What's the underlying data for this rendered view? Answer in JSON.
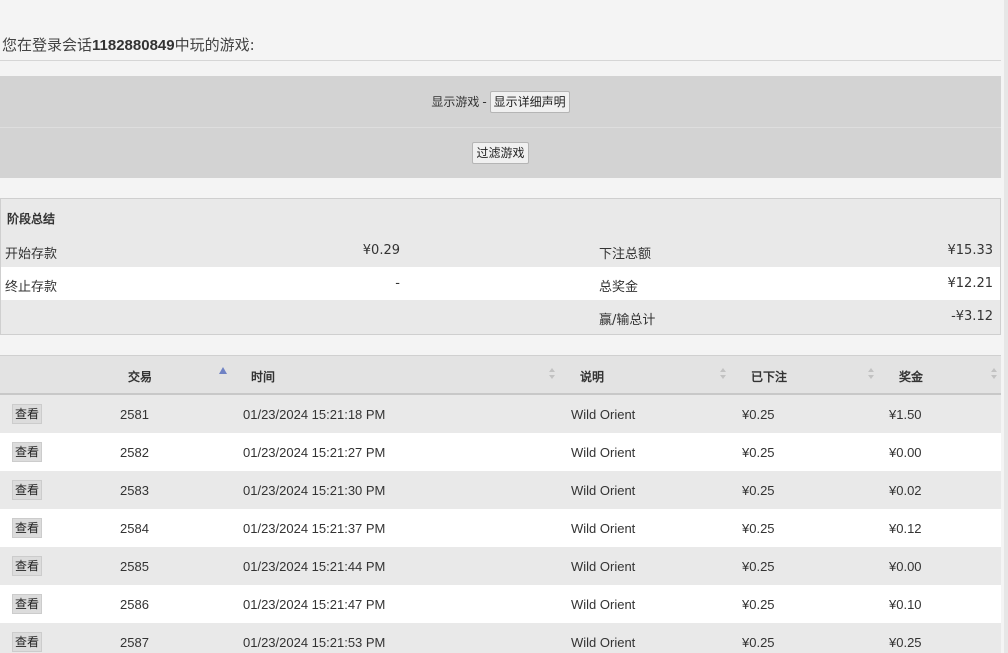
{
  "session": {
    "prefix": "您在登录会话",
    "session_id": "1182880849",
    "suffix": "中玩的游戏:"
  },
  "filters": {
    "show_games_label": "显示游戏",
    "separator": "-",
    "show_details_button": "显示详细声明",
    "filter_games_button": "过滤游戏"
  },
  "summary": {
    "title": "阶段总结",
    "rows": [
      {
        "label1": "开始存款",
        "value1": "¥0.29",
        "label2": "下注总额",
        "value2": "¥15.33"
      },
      {
        "label1": "终止存款",
        "value1": "-",
        "label2": "总奖金",
        "value2": "¥12.21"
      },
      {
        "label1": "",
        "value1": "",
        "label2": "赢/输总计",
        "value2": "-¥3.12"
      }
    ]
  },
  "grid": {
    "columns": [
      "交易",
      "时间",
      "说明",
      "已下注",
      "奖金"
    ],
    "view_label": "查看",
    "rows": [
      {
        "id": "2581",
        "time": "01/23/2024 15:21:18 PM",
        "desc": "Wild Orient",
        "bet": "¥0.25",
        "win": "¥1.50"
      },
      {
        "id": "2582",
        "time": "01/23/2024 15:21:27 PM",
        "desc": "Wild Orient",
        "bet": "¥0.25",
        "win": "¥0.00"
      },
      {
        "id": "2583",
        "time": "01/23/2024 15:21:30 PM",
        "desc": "Wild Orient",
        "bet": "¥0.25",
        "win": "¥0.02"
      },
      {
        "id": "2584",
        "time": "01/23/2024 15:21:37 PM",
        "desc": "Wild Orient",
        "bet": "¥0.25",
        "win": "¥0.12"
      },
      {
        "id": "2585",
        "time": "01/23/2024 15:21:44 PM",
        "desc": "Wild Orient",
        "bet": "¥0.25",
        "win": "¥0.00"
      },
      {
        "id": "2586",
        "time": "01/23/2024 15:21:47 PM",
        "desc": "Wild Orient",
        "bet": "¥0.25",
        "win": "¥0.10"
      },
      {
        "id": "2587",
        "time": "01/23/2024 15:21:53 PM",
        "desc": "Wild Orient",
        "bet": "¥0.25",
        "win": "¥0.25"
      }
    ]
  }
}
